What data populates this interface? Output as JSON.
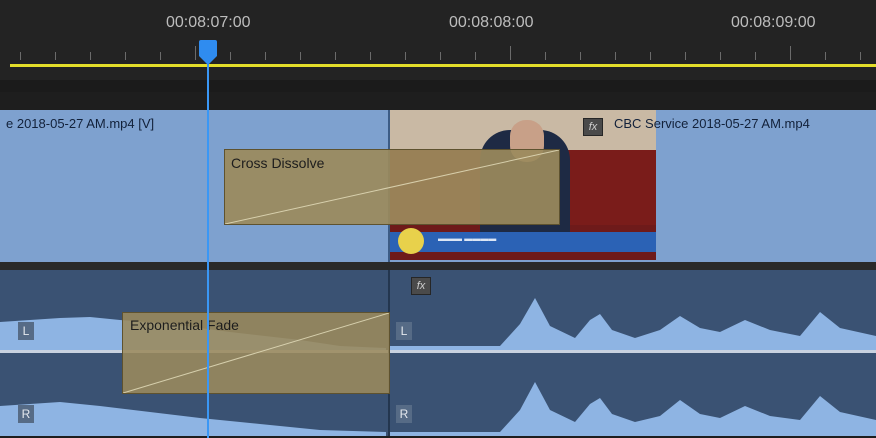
{
  "ruler": {
    "timecodes": [
      "00:08:07:00",
      "00:08:08:00",
      "00:08:09:00"
    ]
  },
  "colors": {
    "video_track": "#7ea1cf",
    "audio_track": "#3a5273",
    "transition": "#9b8a5c",
    "playhead": "#2f8cf0",
    "work_area_bar": "#e3dd2a"
  },
  "video_track": {
    "clip_left_label": "e 2018-05-27 AM.mp4 [V]",
    "clip_right_label": "CBC Service 2018-05-27 AM.mp4",
    "fx_badge": "fx",
    "transition_label": "Cross Dissolve"
  },
  "audio_track": {
    "fx_badge": "fx",
    "transition_label": "Exponential Fade",
    "channel_left": "L",
    "channel_right": "R"
  }
}
